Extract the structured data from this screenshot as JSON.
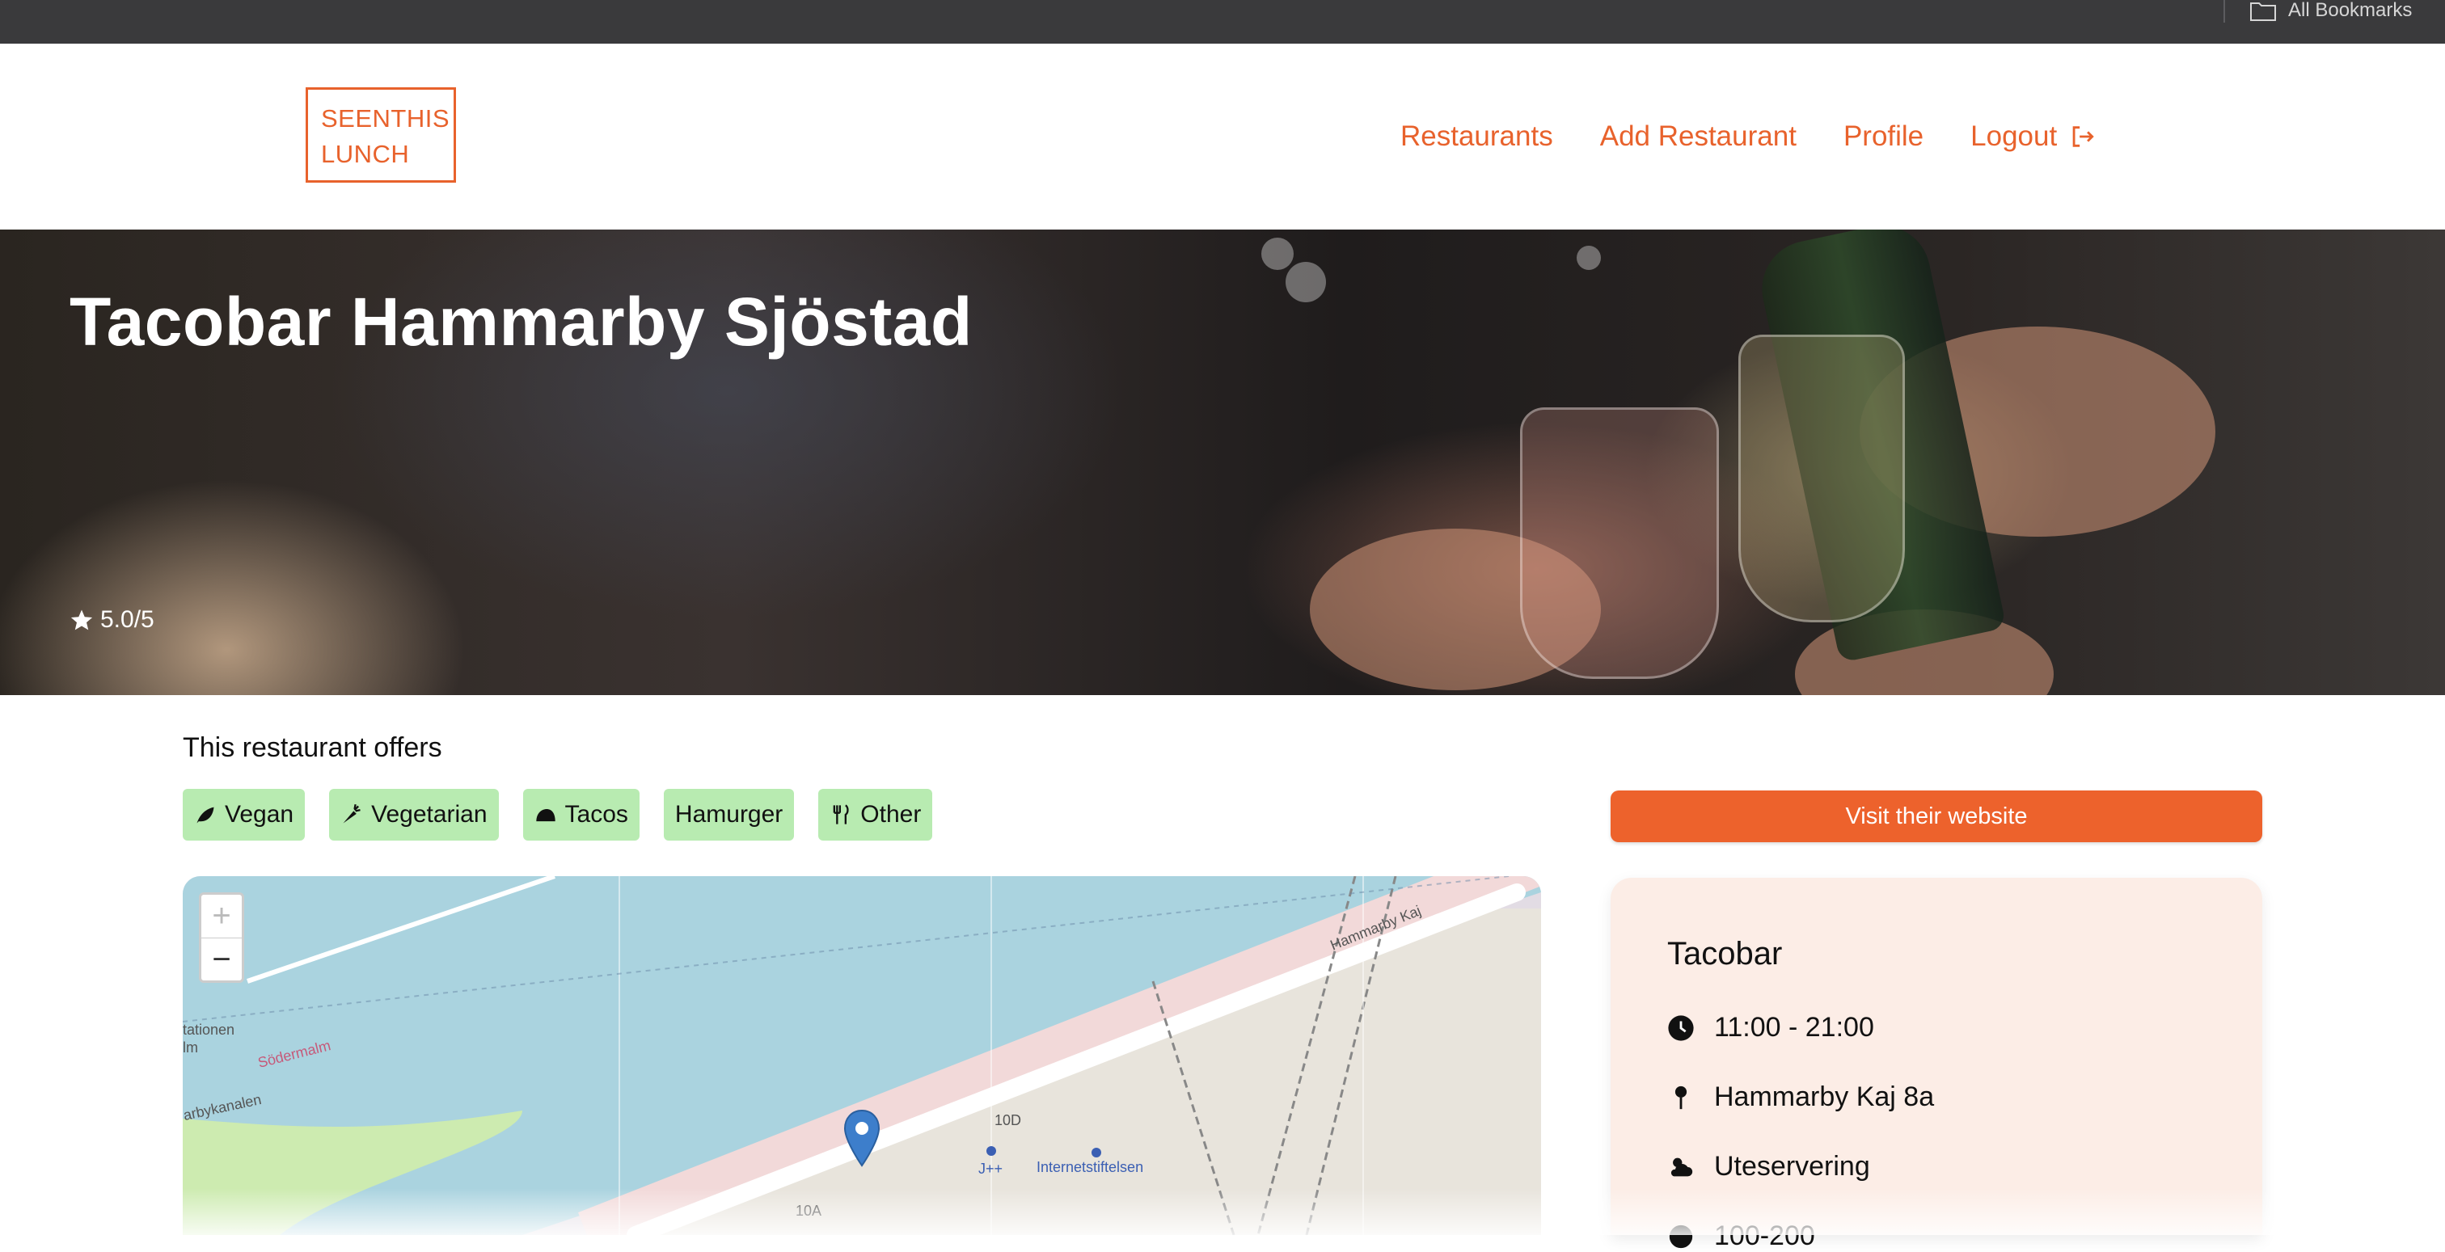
{
  "browser": {
    "bookmarks_label": "All Bookmarks",
    "bookmarks_icon": "folder-icon"
  },
  "header": {
    "logo_line1": "SEENTHIS",
    "logo_line2": "LUNCH",
    "nav": {
      "restaurants": "Restaurants",
      "add_restaurant": "Add Restaurant",
      "profile": "Profile",
      "logout": "Logout"
    },
    "accent_color": "#e8622c"
  },
  "hero": {
    "title": "Tacobar Hammarby Sjöstad",
    "rating": "5.0/5"
  },
  "offers": {
    "heading": "This restaurant offers",
    "tags": [
      {
        "label": "Vegan",
        "icon": "leaf-icon"
      },
      {
        "label": "Vegetarian",
        "icon": "carrot-icon"
      },
      {
        "label": "Tacos",
        "icon": "taco-icon"
      },
      {
        "label": "Hamurger",
        "icon": ""
      },
      {
        "label": "Other",
        "icon": "utensils-icon"
      }
    ],
    "tag_color": "#b8ebb1"
  },
  "map": {
    "zoom_in": "+",
    "zoom_out": "−",
    "labels": {
      "street": "Hammarby Kaj",
      "area": "Södermalm",
      "station": "tationen",
      "station2": "lm",
      "canal": "arbykanalen",
      "poi": "Internetstiftelsen",
      "num1": "10D",
      "num2": "10A",
      "num3": "J++"
    }
  },
  "sidebar": {
    "visit_button": "Visit their website",
    "button_color": "#ed622c",
    "card_title": "Tacobar",
    "hours": "11:00 - 21:00",
    "address": "Hammarby Kaj 8a",
    "feature": "Uteservering",
    "price": "100-200"
  }
}
